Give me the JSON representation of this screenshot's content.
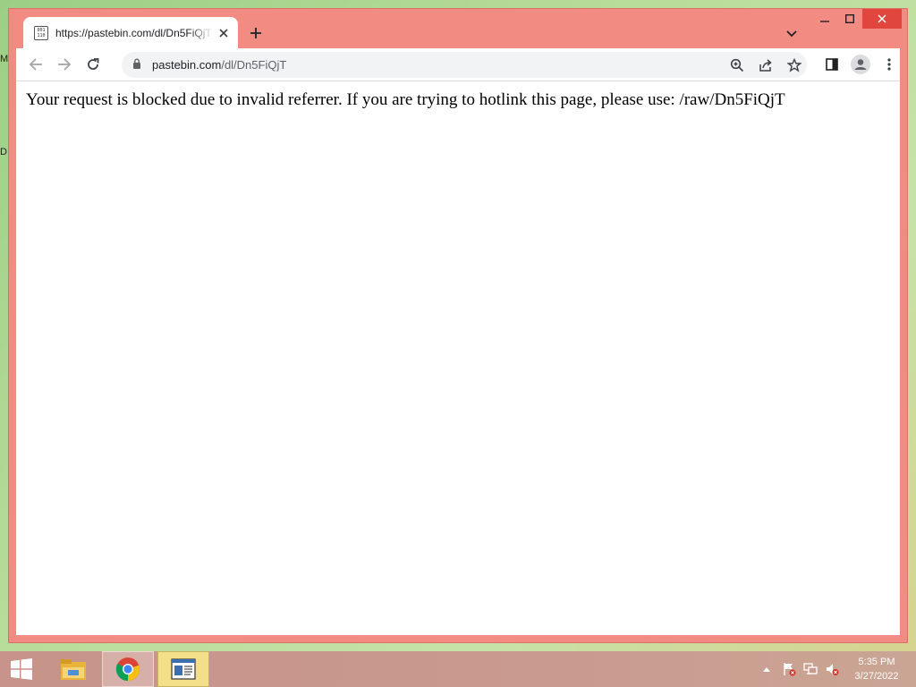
{
  "desktop": {
    "fragments": [
      "M",
      "D"
    ]
  },
  "browser": {
    "tab": {
      "title": "https://pastebin.com/dl/Dn5FiQjT",
      "favicon_text": "001\n110"
    },
    "address": {
      "host": "pastebin.com",
      "path": "/dl/Dn5FiQjT"
    },
    "colors": {
      "frame": "#f28b82",
      "close_hover": "#e0463d"
    }
  },
  "page": {
    "message": "Your request is blocked due to invalid referrer. If you are trying to hotlink this page, please use: /raw/Dn5FiQjT"
  },
  "taskbar": {
    "clock_time": "5:35 PM",
    "clock_date": "3/27/2022",
    "icons": [
      "windows-start-icon",
      "file-explorer-icon",
      "chrome-icon",
      "app-icon",
      "show-hidden-icon",
      "action-center-flag-icon",
      "network-icon",
      "volume-muted-icon"
    ]
  }
}
